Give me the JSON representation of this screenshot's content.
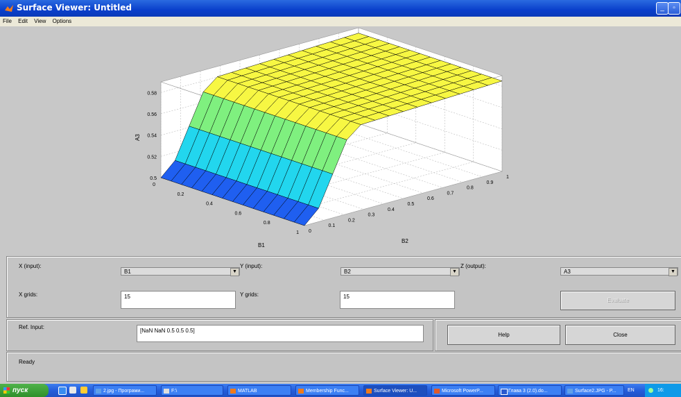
{
  "window": {
    "title": "Surface Viewer: Untitled"
  },
  "menu": [
    "File",
    "Edit",
    "View",
    "Options"
  ],
  "chart_data": {
    "type": "surface",
    "xlabel": "B1",
    "ylabel": "B2",
    "zlabel": "A3",
    "x_ticks": [
      "0",
      "0.2",
      "0.4",
      "0.6",
      "0.8",
      "1"
    ],
    "y_ticks": [
      "0",
      "0.1",
      "0.2",
      "0.3",
      "0.4",
      "0.5",
      "0.6",
      "0.7",
      "0.8",
      "0.9",
      "1"
    ],
    "z_ticks": [
      "0.5",
      "0.52",
      "0.54",
      "0.56",
      "0.58"
    ],
    "xlim": [
      0,
      1
    ],
    "ylim": [
      0,
      1
    ],
    "zlim": [
      0.5,
      0.59
    ],
    "grid_x": 15,
    "grid_y": 15,
    "z_profile_over_B2": [
      {
        "B2": 0.0,
        "A3": 0.5
      },
      {
        "B2": 0.04,
        "A3": 0.5
      },
      {
        "B2": 0.24,
        "A3": 0.58
      },
      {
        "B2": 1.0,
        "A3": 0.585
      }
    ],
    "colormap": [
      "#1f5ff0",
      "#22d6ee",
      "#7ff07f",
      "#f7f743"
    ],
    "grid": true
  },
  "controls": {
    "x_input_label": "X (input):",
    "x_input_value": "B1",
    "y_input_label": "Y (input):",
    "y_input_value": "B2",
    "z_output_label": "Z (output):",
    "z_output_value": "A3",
    "x_grids_label": "X grids:",
    "x_grids_value": "15",
    "y_grids_label": "Y grids:",
    "y_grids_value": "15",
    "evaluate_label": "Evaluate",
    "ref_input_label": "Ref. Input:",
    "ref_input_value": "[NaN NaN 0.5 0.5 0.5]",
    "help_label": "Help",
    "close_label": "Close"
  },
  "status": "Ready",
  "taskbar": {
    "start_label": "пуск",
    "tasks": [
      {
        "label": "2.jpg - Програми..."
      },
      {
        "label": "F:\\"
      },
      {
        "label": "MATLAB"
      },
      {
        "label": "Membership Func..."
      },
      {
        "label": "Surface Viewer: U..."
      },
      {
        "label": "Microsoft PowerP..."
      },
      {
        "label": "Глава 3 (2.0).do..."
      },
      {
        "label": "Surface2.JPG - P..."
      }
    ],
    "lang": "EN",
    "clock": "16:"
  }
}
